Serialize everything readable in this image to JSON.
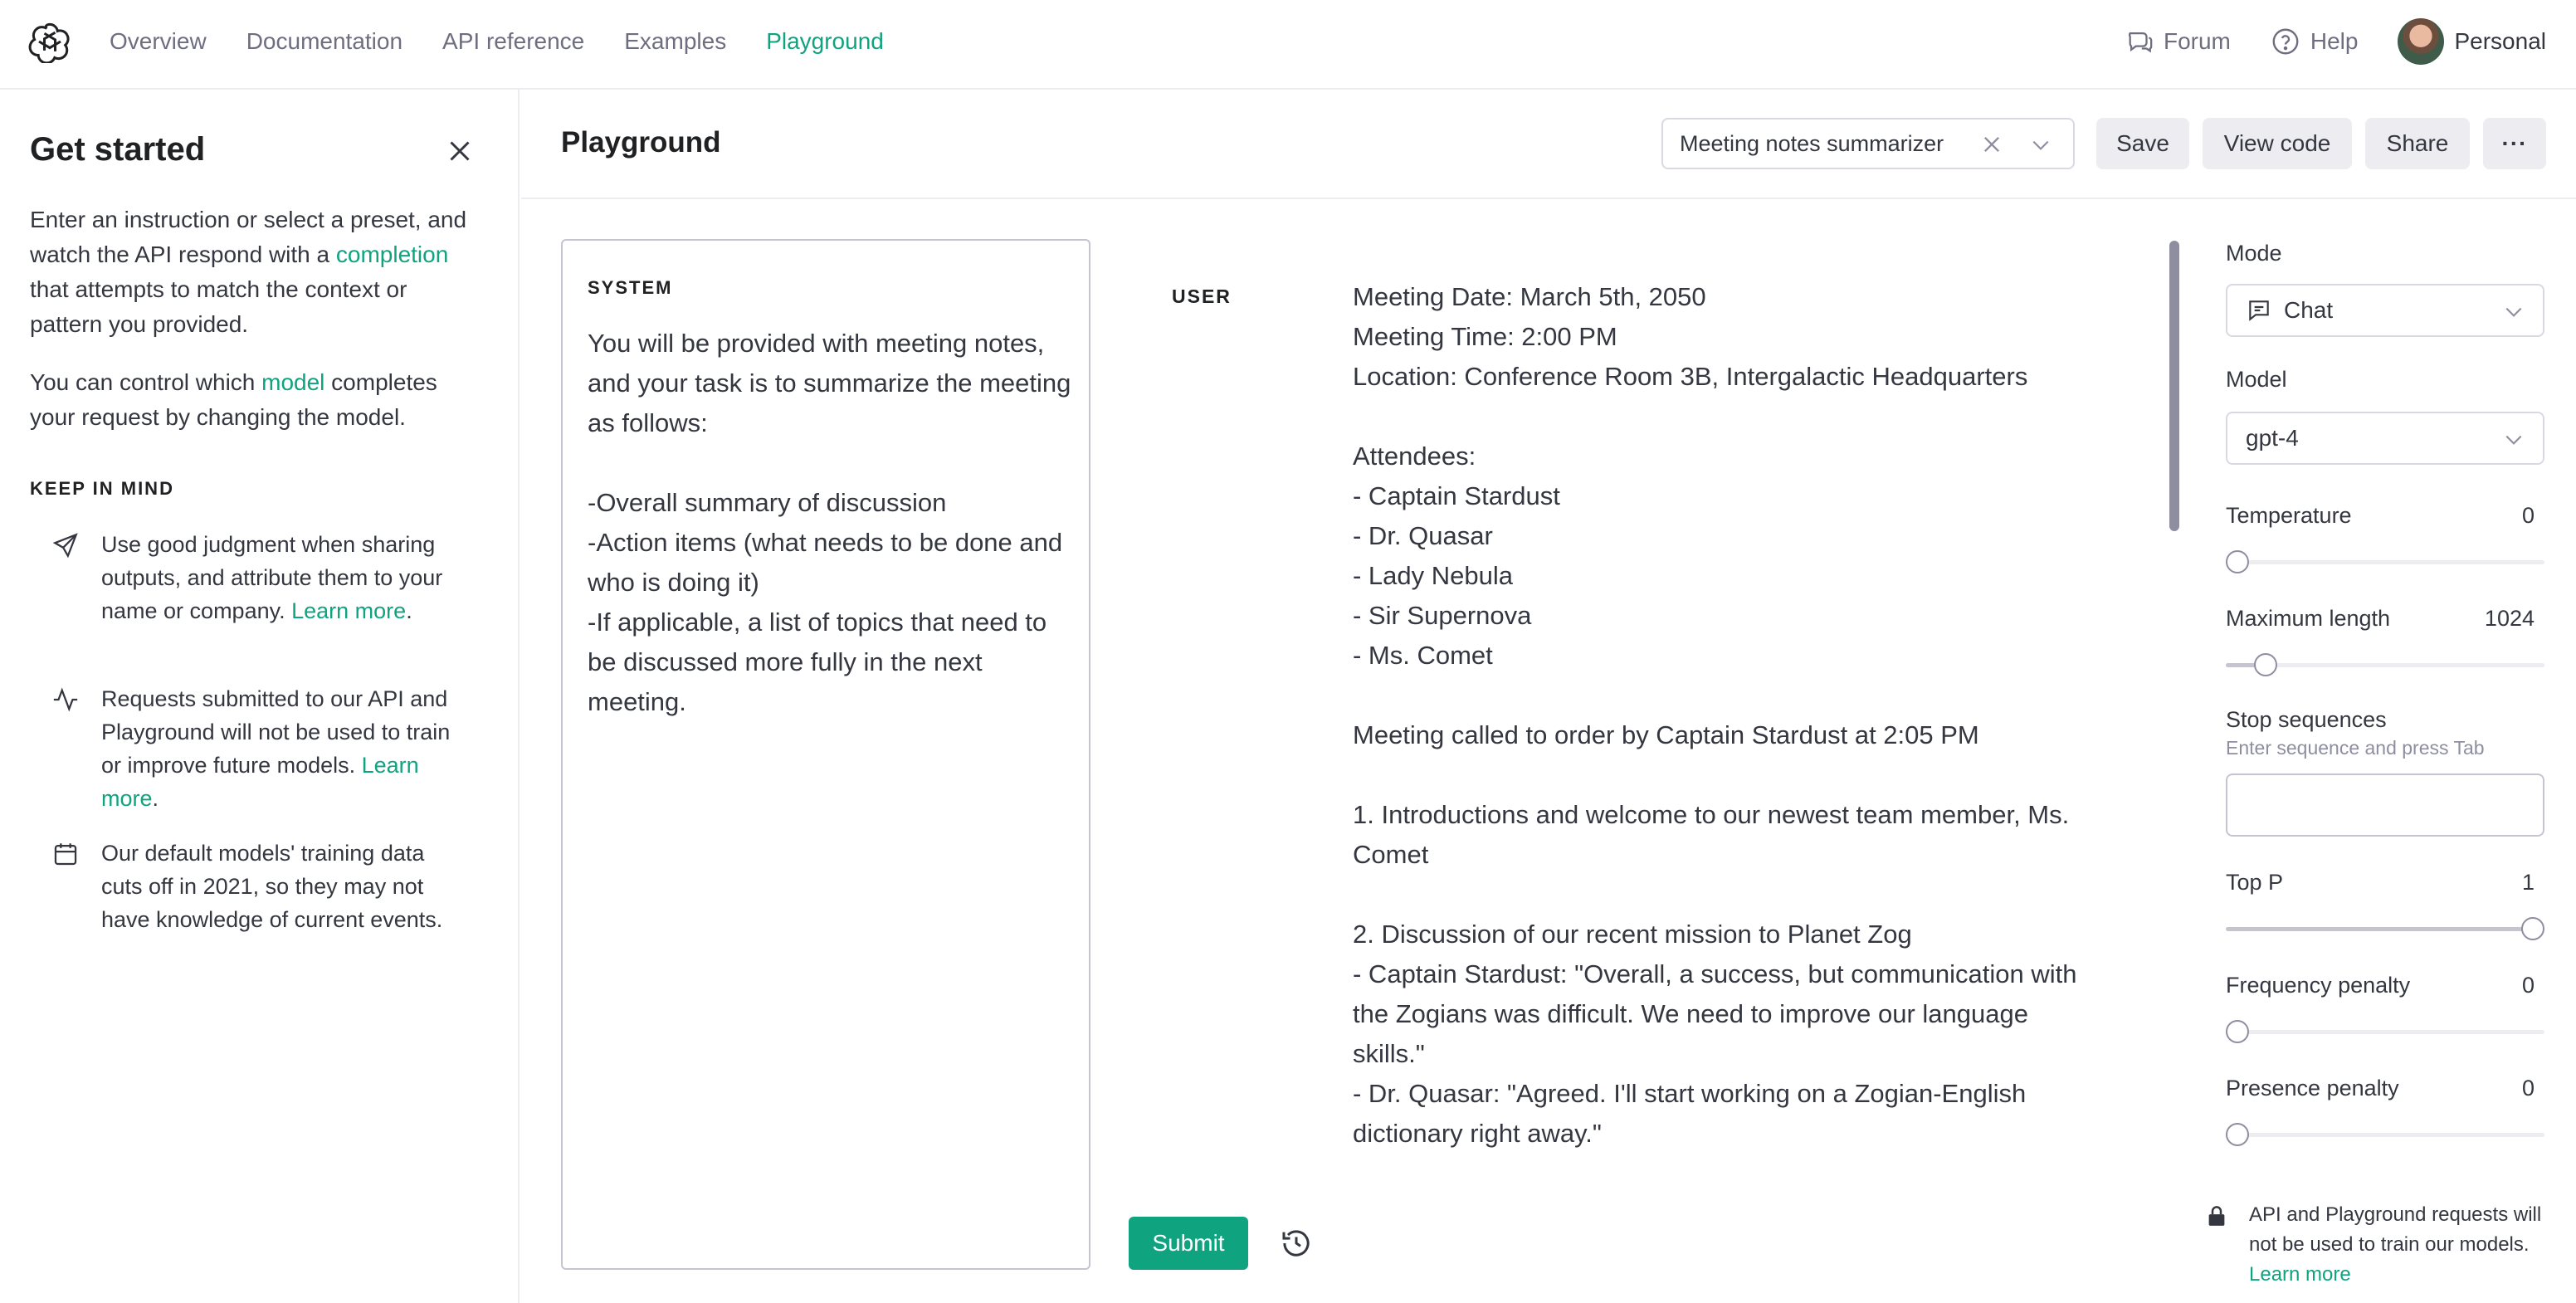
{
  "nav": {
    "links": [
      "Overview",
      "Documentation",
      "API reference",
      "Examples",
      "Playground"
    ],
    "active": "Playground",
    "forum": "Forum",
    "help": "Help",
    "account": "Personal"
  },
  "sidebar": {
    "title": "Get started",
    "intro": {
      "part1": "Enter an instruction or select a preset, and watch the API respond with a ",
      "link": "completion",
      "part2": " that attempts to match the context or pattern you provided."
    },
    "model_para": {
      "part1": "You can control which ",
      "link": "model",
      "part2": " completes your request by changing the model."
    },
    "keep_in_mind": "KEEP IN MIND",
    "tips": [
      {
        "text": "Use good judgment when sharing outputs, and attribute them to your name or company. ",
        "link": "Learn more",
        "tail": "."
      },
      {
        "text": "Requests submitted to our API and Playground will not be used to train or improve future models. ",
        "link": "Learn more",
        "tail": "."
      },
      {
        "text": "Our default models' training data cuts off in 2021, so they may not have knowledge of current events.",
        "link": "",
        "tail": ""
      }
    ]
  },
  "header": {
    "title": "Playground",
    "preset": "Meeting notes summarizer",
    "save": "Save",
    "view_code": "View code",
    "share": "Share",
    "more": "···"
  },
  "system": {
    "label": "SYSTEM",
    "text": "You will be provided with meeting notes, and your task is to summarize the meeting as follows:\n\n-Overall summary of discussion\n-Action items (what needs to be done and who is doing it)\n-If applicable, a list of topics that need to be discussed more fully in the next meeting."
  },
  "user": {
    "label": "USER",
    "text": "Meeting Date: March 5th, 2050\nMeeting Time: 2:00 PM\nLocation: Conference Room 3B, Intergalactic Headquarters\n\nAttendees:\n- Captain Stardust\n- Dr. Quasar\n- Lady Nebula\n- Sir Supernova\n- Ms. Comet\n\nMeeting called to order by Captain Stardust at 2:05 PM\n\n1. Introductions and welcome to our newest team member, Ms. Comet\n\n2. Discussion of our recent mission to Planet Zog\n- Captain Stardust: \"Overall, a success, but communication with the Zogians was difficult. We need to improve our language skills.\"\n- Dr. Quasar: \"Agreed. I'll start working on a Zogian-English dictionary right away.\""
  },
  "actions": {
    "submit": "Submit"
  },
  "settings": {
    "mode_label": "Mode",
    "mode_value": "Chat",
    "model_label": "Model",
    "model_value": "gpt-4",
    "temperature": {
      "label": "Temperature",
      "value": "0",
      "fraction": 0
    },
    "max_length": {
      "label": "Maximum length",
      "value": "1024",
      "fraction": 0.125
    },
    "stop": {
      "label": "Stop sequences",
      "hint": "Enter sequence and press Tab"
    },
    "top_p": {
      "label": "Top P",
      "value": "1",
      "fraction": 1
    },
    "frequency": {
      "label": "Frequency penalty",
      "value": "0",
      "fraction": 0
    },
    "presence": {
      "label": "Presence penalty",
      "value": "0",
      "fraction": 0
    },
    "notice": {
      "text": "API and Playground requests will not be used to train our models. ",
      "link": "Learn more"
    }
  },
  "colors": {
    "accent": "#10a37f",
    "border": "#d9d9e3",
    "muted": "#6e6e80"
  }
}
